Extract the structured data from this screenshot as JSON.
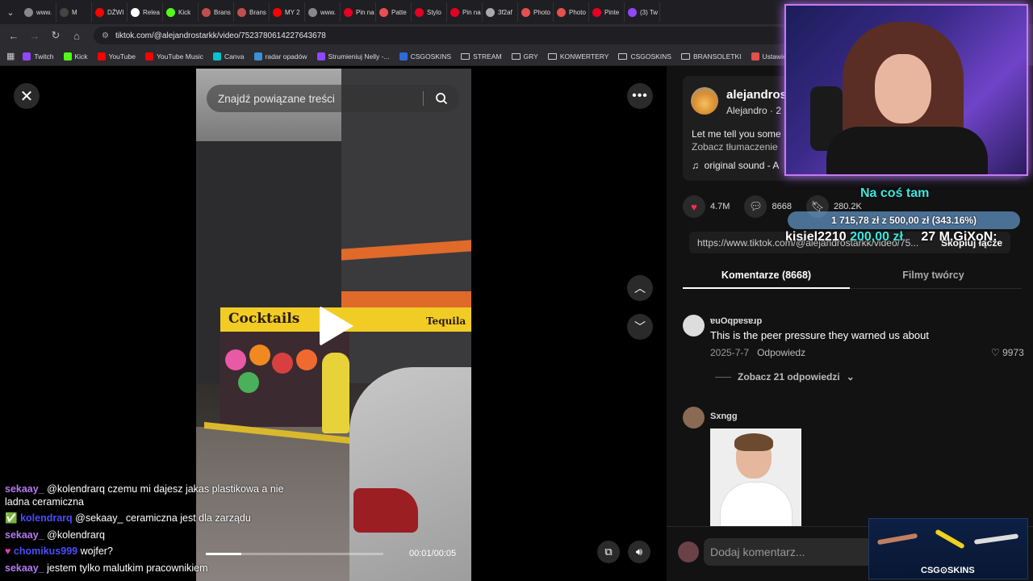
{
  "browser": {
    "tabs": [
      {
        "label": "www.",
        "color": "#888888"
      },
      {
        "label": "M",
        "color": "#444444"
      },
      {
        "label": "DŹWI",
        "color": "#ff0000"
      },
      {
        "label": "Relea",
        "color": "#ffffff"
      },
      {
        "label": "Kick",
        "color": "#53fc18"
      },
      {
        "label": "Brans",
        "color": "#c0504d"
      },
      {
        "label": "Brans",
        "color": "#c0504d"
      },
      {
        "label": "MY 2",
        "color": "#ff0000"
      },
      {
        "label": "www.",
        "color": "#888888"
      },
      {
        "label": "Pin na",
        "color": "#e60023"
      },
      {
        "label": "Patte",
        "color": "#e85050"
      },
      {
        "label": "Stylo",
        "color": "#e60023"
      },
      {
        "label": "Pin na",
        "color": "#e60023"
      },
      {
        "label": "3f2af",
        "color": "#aaaaaa"
      },
      {
        "label": "Photo",
        "color": "#e85050"
      },
      {
        "label": "Photo",
        "color": "#e85050"
      },
      {
        "label": "Pinte",
        "color": "#e60023"
      },
      {
        "label": "(3) Tw",
        "color": "#9146ff"
      }
    ],
    "url": "tiktok.com/@alejandrostarkk/video/7523780614227643678",
    "bookmarks": [
      {
        "label": "Twitch",
        "type": "site",
        "color": "#9146ff"
      },
      {
        "label": "Kick",
        "type": "site",
        "color": "#53fc18"
      },
      {
        "label": "YouTube",
        "type": "site",
        "color": "#ff0000"
      },
      {
        "label": "YouTube Music",
        "type": "site",
        "color": "#ff0000"
      },
      {
        "label": "Canva",
        "type": "site",
        "color": "#00c4cc"
      },
      {
        "label": "radar opadów",
        "type": "site",
        "color": "#3a8fd6"
      },
      {
        "label": "Strumieniuj Nelly -...",
        "type": "site",
        "color": "#9146ff"
      },
      {
        "label": "CSGOSKINS",
        "type": "site",
        "color": "#2d6bd6"
      },
      {
        "label": "STREAM",
        "type": "folder"
      },
      {
        "label": "GRY",
        "type": "folder"
      },
      {
        "label": "KONWERTERY",
        "type": "folder"
      },
      {
        "label": "CSGOSKINS",
        "type": "folder"
      },
      {
        "label": "BRANSOLETKI",
        "type": "folder"
      },
      {
        "label": "Ustawienia strumien...",
        "type": "site",
        "color": "#e05050"
      }
    ]
  },
  "video": {
    "search_placeholder": "Znajdź powiązane treści",
    "time": "00:01/00:05",
    "progress_fraction": 0.2,
    "sign_left": "Cocktails",
    "sign_right": "Tequila"
  },
  "author": {
    "handle": "alejandros",
    "name_line": "Alejandro · 2",
    "description": "Let me tell you some",
    "translate": "Zobacz tłumaczenie",
    "sound": "original sound - A"
  },
  "actions": {
    "likes": "4.7M",
    "comments": "8668",
    "saves": "280.2K"
  },
  "link": "https://www.tiktok.com/@alejandrostarkk/video/75...",
  "copy_link": "Skopiuj łącze",
  "tabs": {
    "comments": "Komentarze (8668)",
    "creator_videos": "Filmy twórcy"
  },
  "comments": [
    {
      "user": "ɐuOqpɐsɐɹp",
      "text": "This is the peer pressure they warned us about",
      "date": "2025-7-7",
      "reply": "Odpowiedz",
      "likes": "9973",
      "replies": "Zobacz 21 odpowiedzi"
    },
    {
      "user": "Sxngg"
    }
  ],
  "comment_input_placeholder": "Dodaj komentarz...",
  "stream_overlay": {
    "goal_title": "Na coś tam",
    "goal_progress": "1 715,78 zł z 500,00 zł (343.16%)",
    "donor_name": "kisiel2210",
    "donor_amount": "200,00 zł",
    "donor2": "27 M.GiXoN:",
    "chat": [
      {
        "user": "sekaay_",
        "text": "@kolendrarq czemu mi dajesz jakas plastikowa a nie",
        "cont": "ladna ceramiczna"
      },
      {
        "user": "kolendrarq",
        "text": "@sekaay_ ceramiczna jest dla zarządu"
      },
      {
        "user": "sekaay_",
        "text": "@kolendrarq"
      },
      {
        "user": "chomikus999",
        "text": "wojfer?"
      },
      {
        "user": "sekaay_",
        "text": "jestem tylko malutkim pracownikiem"
      }
    ],
    "sponsor": "CSG⊙SKINS"
  }
}
